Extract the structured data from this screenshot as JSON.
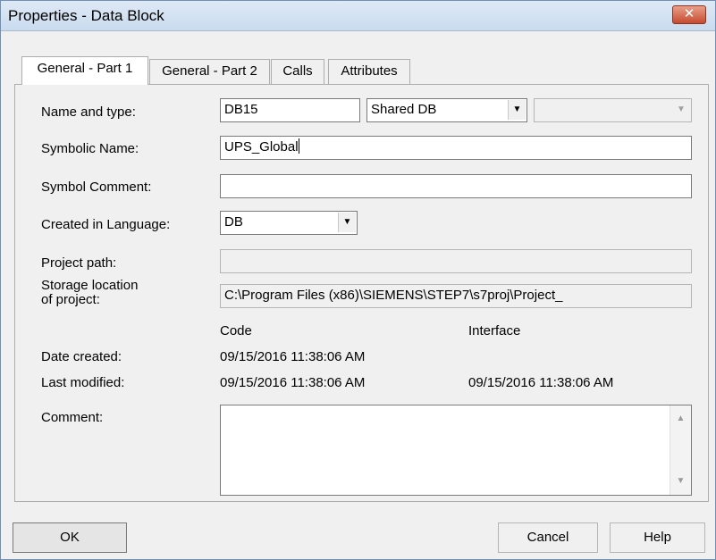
{
  "window": {
    "title": "Properties - Data Block",
    "close_glyph": "✕"
  },
  "tabs": [
    {
      "label": "General - Part 1",
      "active": true
    },
    {
      "label": "General - Part 2",
      "active": false
    },
    {
      "label": "Calls",
      "active": false
    },
    {
      "label": "Attributes",
      "active": false
    }
  ],
  "form": {
    "name_type_label": "Name and type:",
    "name_value": "DB15",
    "type_value": "Shared DB",
    "third_value": "",
    "symbolic_name_label": "Symbolic Name:",
    "symbolic_name_value": "UPS_Global",
    "symbol_comment_label": "Symbol Comment:",
    "symbol_comment_value": "",
    "language_label": "Created in Language:",
    "language_value": "DB",
    "project_path_label": "Project path:",
    "project_path_value": "",
    "storage_label_line1": "Storage location",
    "storage_label_line2": "of project:",
    "storage_value": "C:\\Program Files (x86)\\SIEMENS\\STEP7\\s7proj\\Project_",
    "code_header": "Code",
    "interface_header": "Interface",
    "date_created_label": "Date created:",
    "date_created_code": "09/15/2016 11:38:06 AM",
    "last_modified_label": "Last modified:",
    "last_modified_code": "09/15/2016 11:38:06 AM",
    "last_modified_interface": "09/15/2016 11:38:06 AM",
    "comment_label": "Comment:",
    "comment_value": ""
  },
  "buttons": {
    "ok": "OK",
    "cancel": "Cancel",
    "help": "Help"
  },
  "icons": {
    "dropdown": "chevron-down-icon",
    "scroll_up": "scroll-up-icon",
    "scroll_down": "scroll-down-icon"
  },
  "colors": {
    "title_bar": "#c9dbef",
    "close_button": "#c64a2f",
    "panel": "#ffffff",
    "dialog": "#f0f0f0"
  }
}
